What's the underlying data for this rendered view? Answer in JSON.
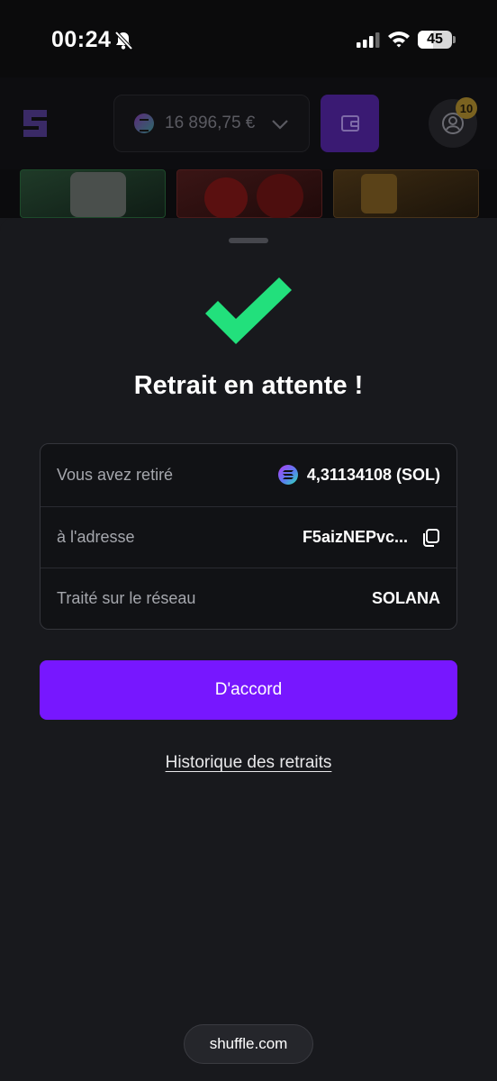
{
  "status_bar": {
    "time": "00:24",
    "battery": "45",
    "battery_level": 0.45,
    "icons": [
      "bell-slash-icon",
      "signal-icon",
      "wifi-icon",
      "battery-icon"
    ]
  },
  "header": {
    "logo": "shuffle-logo",
    "balance": "16 896,75 €",
    "notification_count": "10",
    "wallet_icon": "wallet-icon",
    "profile_icon": "user-icon",
    "accent_color": "#7717ff"
  },
  "sheet": {
    "title": "Retrait en attente !",
    "icon": "checkmark-icon",
    "check_color": "#22e07c",
    "rows": [
      {
        "label": "Vous avez retiré",
        "value": "4,31134108 (SOL)",
        "icon": "solana-icon"
      },
      {
        "label": "à l'adresse",
        "value": "F5aizNEPvc...",
        "icon": "copy-icon"
      },
      {
        "label": "Traité sur le réseau",
        "value": "SOLANA"
      }
    ],
    "confirm_label": "D'accord",
    "history_link": "Historique des retraits"
  },
  "browser": {
    "url": "shuffle.com"
  }
}
